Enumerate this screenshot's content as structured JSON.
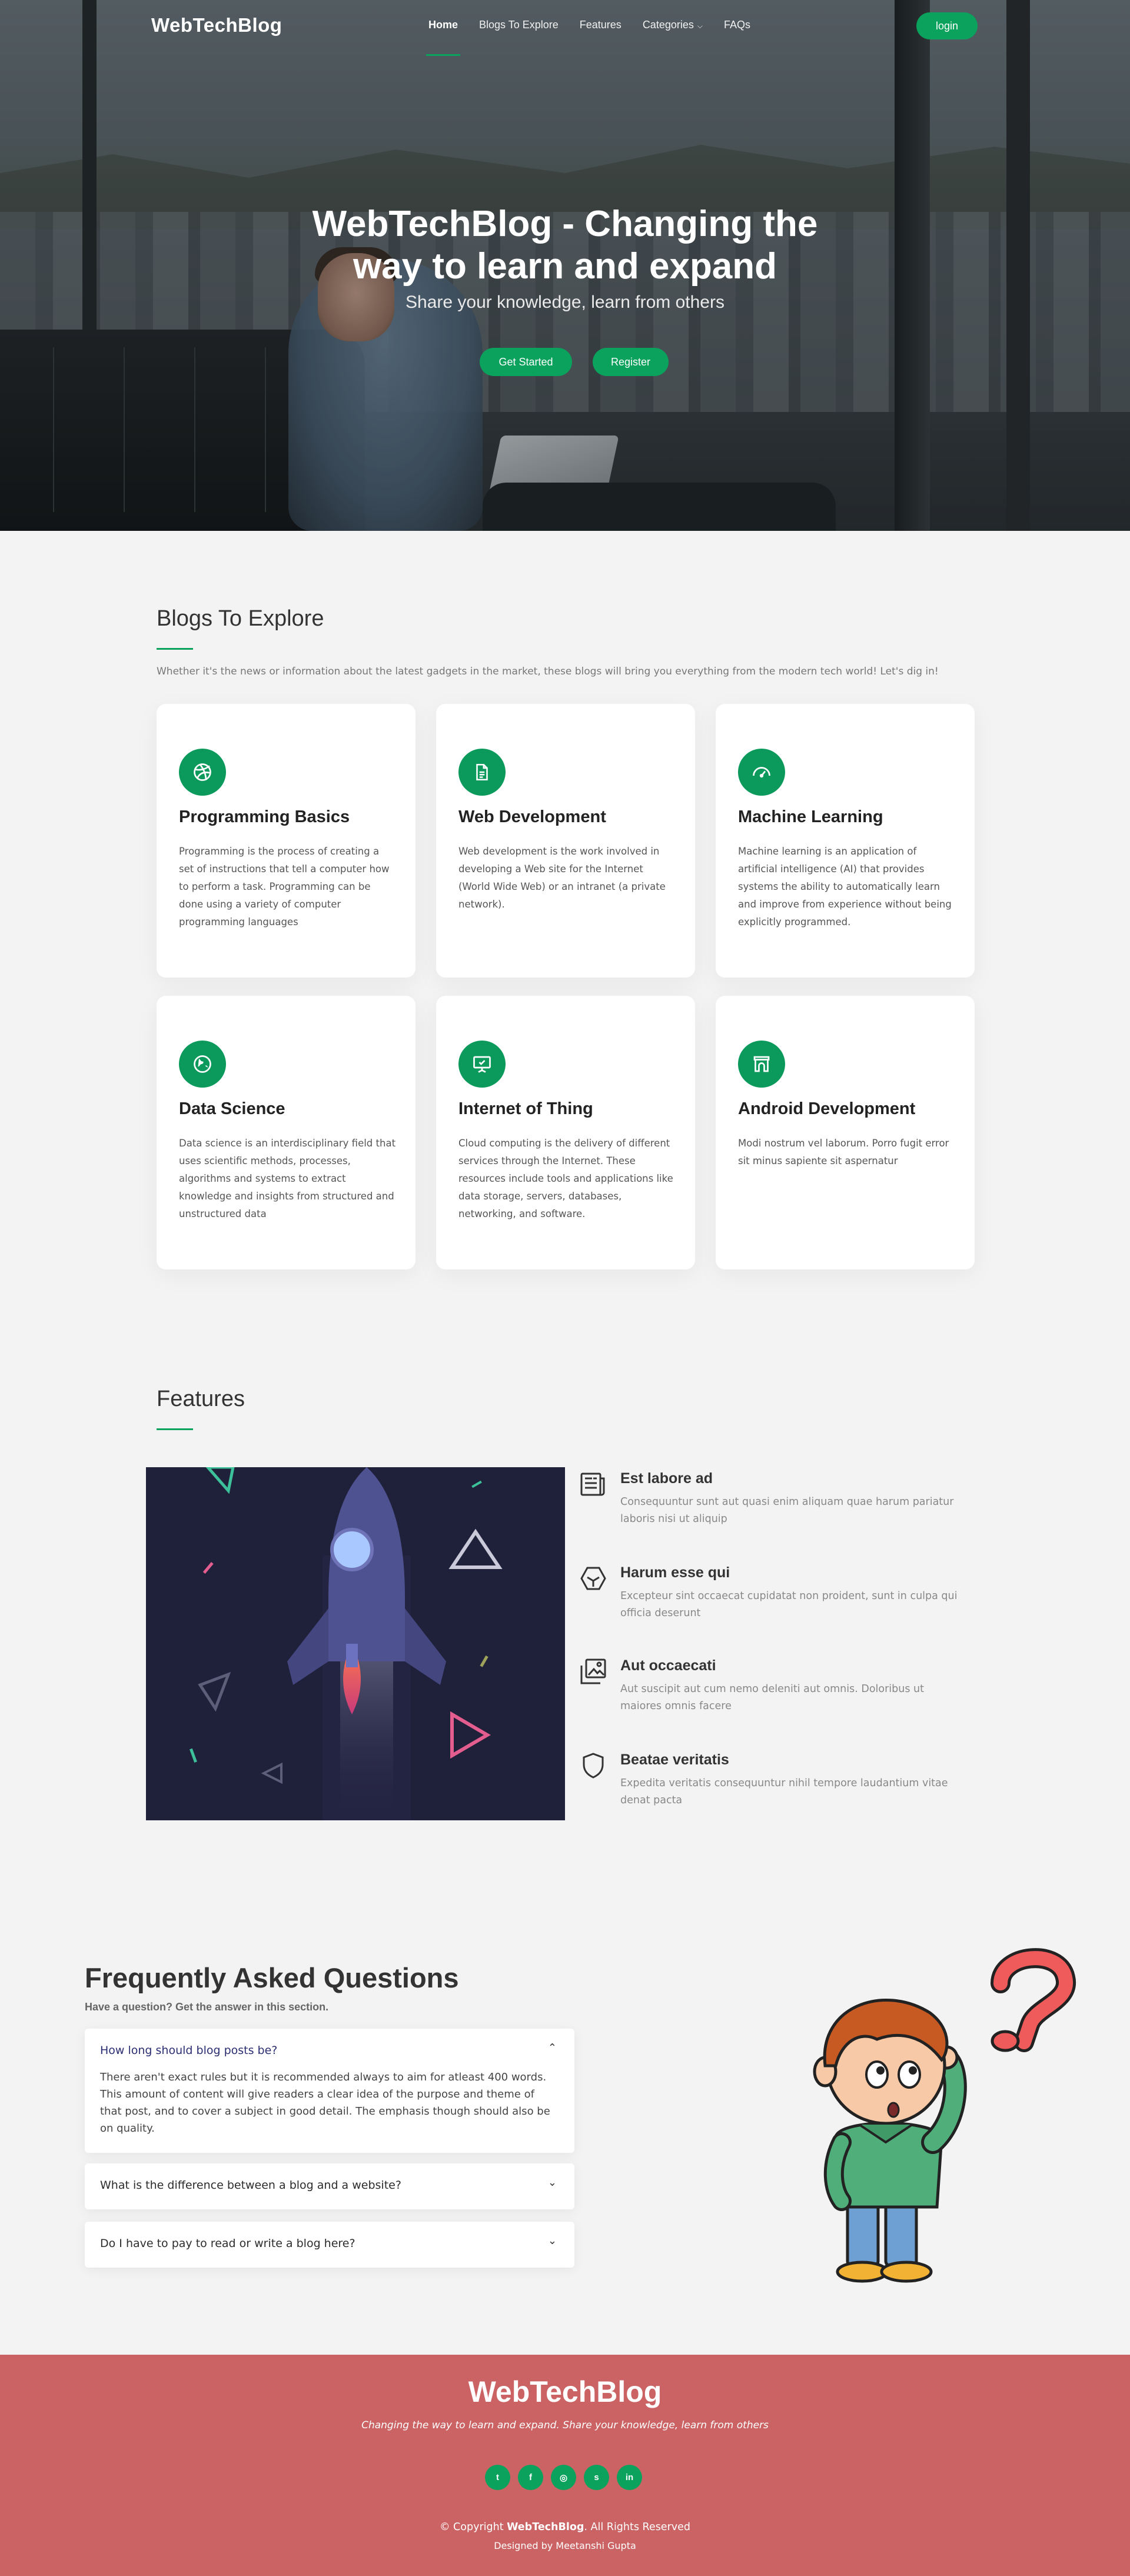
{
  "nav": {
    "brand": "WebTechBlog",
    "items": [
      {
        "label": "Home",
        "active": true
      },
      {
        "label": "Blogs To Explore"
      },
      {
        "label": "Features"
      },
      {
        "label": "Categories",
        "has_dropdown": true,
        "icon": "chevron-down-icon"
      },
      {
        "label": "FAQs"
      }
    ],
    "login_label": "login"
  },
  "hero": {
    "title": "WebTechBlog - Changing the way to learn and expand",
    "subtitle": "Share your knowledge, learn from others",
    "get_started_label": "Get Started",
    "register_label": "Register"
  },
  "blogs": {
    "title": "Blogs To Explore",
    "intro": "Whether it's the news or information about the latest gadgets in the market, these blogs will bring you everything from the modern tech world! Let's dig in!",
    "cards": [
      {
        "icon": "dribbble-icon",
        "title": "Programming Basics",
        "text": "Programming is the process of creating a set of instructions that tell a computer how to perform a task. Programming can be done using a variety of computer programming languages"
      },
      {
        "icon": "file-text-icon",
        "title": "Web Development",
        "text": "Web development is the work involved in developing a Web site for the Internet (World Wide Web) or an intranet (a private network)."
      },
      {
        "icon": "speedometer-icon",
        "title": "Machine Learning",
        "text": "Machine learning is an application of artificial intelligence (AI) that provides systems the ability to automatically learn and improve from experience without being explicitly programmed."
      },
      {
        "icon": "globe-icon",
        "title": "Data Science",
        "text": "Data science is an interdisciplinary field that uses scientific methods, processes, algorithms and systems to extract knowledge and insights from structured and unstructured data"
      },
      {
        "icon": "presentation-icon",
        "title": "Internet of Thing",
        "text": "Cloud computing is the delivery of different services through the Internet. These resources include tools and applications like data storage, servers, databases, networking, and software."
      },
      {
        "icon": "archway-icon",
        "title": "Android Development",
        "text": "Modi nostrum vel laborum. Porro fugit error sit minus sapiente sit aspernatur"
      }
    ]
  },
  "features": {
    "title": "Features",
    "items": [
      {
        "icon": "newspaper-icon",
        "title": "Est labore ad",
        "text": "Consequuntur sunt aut quasi enim aliquam quae harum pariatur laboris nisi ut aliquip"
      },
      {
        "icon": "hexagon-cube-icon",
        "title": "Harum esse qui",
        "text": "Excepteur sint occaecat cupidatat non proident, sunt in culpa qui officia deserunt"
      },
      {
        "icon": "images-icon",
        "title": "Aut occaecati",
        "text": "Aut suscipit aut cum nemo deleniti aut omnis. Doloribus ut maiores omnis facere"
      },
      {
        "icon": "shield-icon",
        "title": "Beatae veritatis",
        "text": "Expedita veritatis consequuntur nihil tempore laudantium vitae denat pacta"
      }
    ]
  },
  "faq": {
    "title_light": "Frequently Asked ",
    "title_bold": "Questions",
    "subtitle": "Have a question? Get the answer in this section.",
    "items": [
      {
        "question": "How long should blog posts be?",
        "open": true,
        "answer": "There aren't exact rules but it is recommended always to aim for atleast 400 words. This amount of content will give readers a clear idea of the purpose and theme of that post, and to cover a subject in good detail. The emphasis though should also be on quality."
      },
      {
        "question": "What is the difference between a blog and a website?",
        "open": false
      },
      {
        "question": "Do I have to pay to read or write a blog here?",
        "open": false
      }
    ]
  },
  "footer": {
    "brand": "WebTechBlog",
    "tagline": "Changing the way to learn and expand. Share your knowledge, learn from others",
    "social": [
      {
        "icon": "twitter-icon",
        "glyph": "t"
      },
      {
        "icon": "facebook-icon",
        "glyph": "f"
      },
      {
        "icon": "instagram-icon",
        "glyph": "◎"
      },
      {
        "icon": "skype-icon",
        "glyph": "s"
      },
      {
        "icon": "linkedin-icon",
        "glyph": "in"
      }
    ],
    "copyright_prefix": "© Copyright ",
    "copyright_brand": "WebTechBlog",
    "copyright_suffix": ". All Rights Reserved",
    "designed_by": "Designed by Meetanshi Gupta"
  },
  "colors": {
    "accent": "#0aa25c",
    "card_icon_bg": "#0b9a5c",
    "footer_bg": "#cb6364",
    "page_bg": "#f3f3f3",
    "faq_open_question": "#2a2d72"
  }
}
